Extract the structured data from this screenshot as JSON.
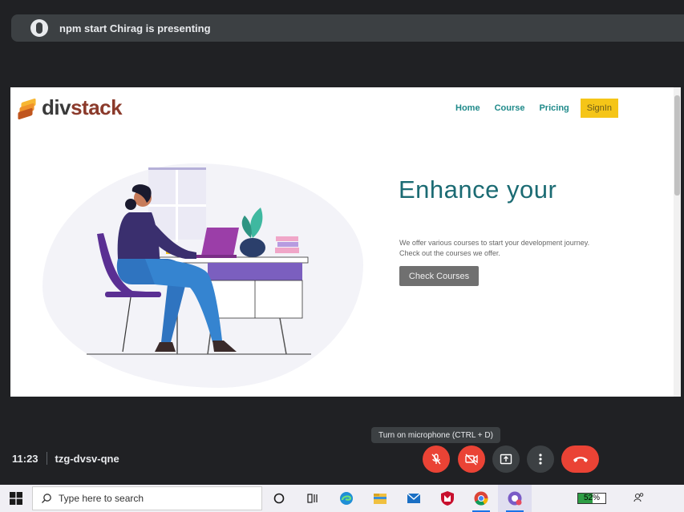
{
  "presenter": {
    "text": "npm start Chirag is presenting"
  },
  "site": {
    "logo_prefix": "div",
    "logo_suffix": "stack",
    "nav": [
      "Home",
      "Course",
      "Pricing"
    ],
    "signin_label": "SignIn",
    "hero_title": "Enhance your",
    "hero_desc_1": "We offer various courses to start your development journey.",
    "hero_desc_2": "Check out the courses we offer.",
    "hero_button": "Check Courses"
  },
  "tooltip": "Turn on microphone (CTRL + D)",
  "meeting": {
    "time": "11:23",
    "code": "tzg-dvsv-qne"
  },
  "controls": {
    "mic": "mic-off-icon",
    "camera": "camera-off-icon",
    "present": "present-screen-icon",
    "more": "more-vert-icon",
    "leave": "call-end-icon"
  },
  "taskbar": {
    "search_placeholder": "Type here to search",
    "battery_percent": "52%",
    "battery_level": 0.52
  },
  "colors": {
    "danger": "#ea4335",
    "brand_teal": "#1b6b73",
    "signin_yellow": "#f5c518",
    "meet_bg": "#202124"
  }
}
